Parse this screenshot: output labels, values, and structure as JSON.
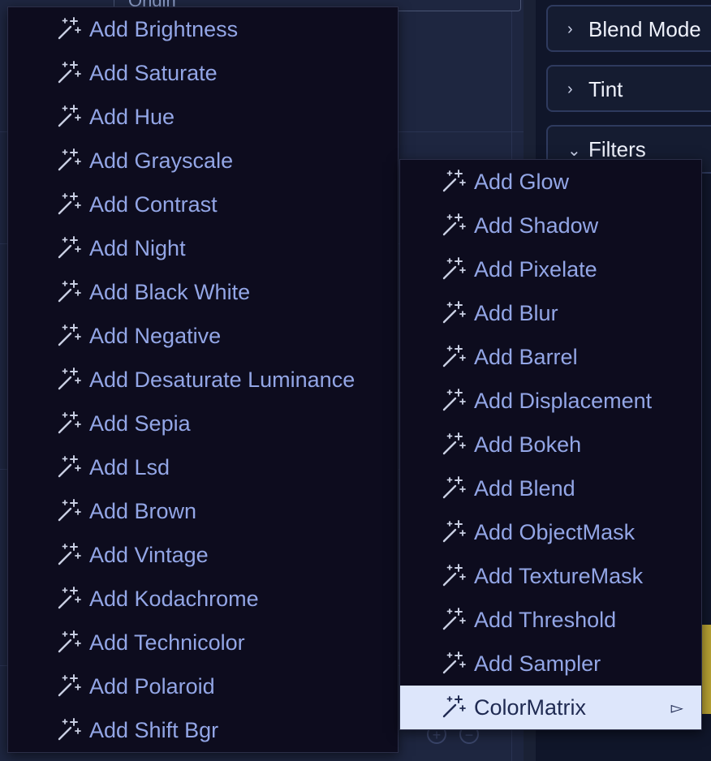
{
  "background": {
    "origin_label": "Origin",
    "panel_rows": [
      {
        "label": "Blend Mode",
        "chevron": "chevron-right-icon"
      },
      {
        "label": "Tint",
        "chevron": "chevron-right-icon"
      },
      {
        "label": "Filters",
        "chevron": "chevron-down-icon"
      }
    ],
    "zoom_in_icon": "zoom-in-icon",
    "zoom_out_icon": "zoom-out-icon"
  },
  "main_menu": {
    "icon": "magic-wand-icon",
    "items": [
      {
        "label": "Add Brightness"
      },
      {
        "label": "Add Saturate"
      },
      {
        "label": "Add Hue"
      },
      {
        "label": "Add Grayscale"
      },
      {
        "label": "Add Contrast"
      },
      {
        "label": "Add Night"
      },
      {
        "label": "Add Black White"
      },
      {
        "label": "Add Negative"
      },
      {
        "label": "Add Desaturate Luminance"
      },
      {
        "label": "Add Sepia"
      },
      {
        "label": "Add Lsd"
      },
      {
        "label": "Add Brown"
      },
      {
        "label": "Add Vintage"
      },
      {
        "label": "Add Kodachrome"
      },
      {
        "label": "Add Technicolor"
      },
      {
        "label": "Add Polaroid"
      },
      {
        "label": "Add Shift Bgr"
      }
    ]
  },
  "sub_menu": {
    "icon": "magic-wand-icon",
    "items": [
      {
        "label": "Add Glow"
      },
      {
        "label": "Add Shadow"
      },
      {
        "label": "Add Pixelate"
      },
      {
        "label": "Add Blur"
      },
      {
        "label": "Add Barrel"
      },
      {
        "label": "Add Displacement"
      },
      {
        "label": "Add Bokeh"
      },
      {
        "label": "Add Blend"
      },
      {
        "label": "Add ObjectMask"
      },
      {
        "label": "Add TextureMask"
      },
      {
        "label": "Add Threshold"
      },
      {
        "label": "Add Sampler"
      },
      {
        "label": "ColorMatrix",
        "highlighted": true,
        "has_submenu": true,
        "arrow": "▻"
      }
    ]
  },
  "colors": {
    "menu_bg": "#0d0c1e",
    "menu_text": "#93a6e6",
    "highlight_bg": "#dde6fb",
    "highlight_text": "#1f2a52",
    "icon_color": "#c9cfe3"
  }
}
